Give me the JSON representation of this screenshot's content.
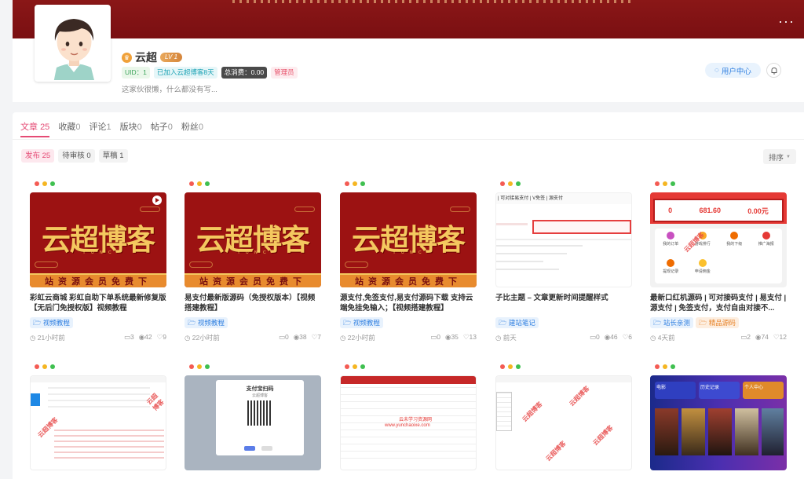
{
  "banner": {
    "more_icon": "ellipsis-icon"
  },
  "user": {
    "name": "云超",
    "level": "LV 1",
    "uid": "UID：1",
    "joined": "已加入云超博客8天",
    "spend": "总消费：0.00",
    "role": "管理员",
    "bio": "这家伙很懒，什么都没有写...",
    "user_center": "用户中心"
  },
  "tabs": [
    {
      "label": "文章",
      "count": "25"
    },
    {
      "label": "收藏",
      "count": "0"
    },
    {
      "label": "评论",
      "count": "1"
    },
    {
      "label": "版块",
      "count": "0"
    },
    {
      "label": "帖子",
      "count": "0"
    },
    {
      "label": "粉丝",
      "count": "0"
    }
  ],
  "subtabs": [
    {
      "label": "发布 25"
    },
    {
      "label": "待审核 0"
    },
    {
      "label": "草稿 1"
    }
  ],
  "sort_label": "排序",
  "red_banner": {
    "big": "云超博客",
    "sub": "Y U N C",
    "strip": "站资源会员免费下"
  },
  "cards": [
    {
      "title": "彩虹云商城 彩虹自助下单系统最新修复版【无后门免授权版】视频教程",
      "tags": [
        {
          "label": "视频教程"
        }
      ],
      "time": "21小时前",
      "comments": "3",
      "views": "42",
      "likes": "9"
    },
    {
      "title": "易支付最新版源码（免授权版本）【视频搭建教程】",
      "tags": [
        {
          "label": "视频教程"
        }
      ],
      "time": "22小时前",
      "comments": "0",
      "views": "38",
      "likes": "7"
    },
    {
      "title": "源支付,免签支付,易支付源码下载 支持云端免挂免输入；【视频搭建教程】",
      "tags": [
        {
          "label": "视频教程"
        }
      ],
      "time": "22小时前",
      "comments": "0",
      "views": "35",
      "likes": "13"
    },
    {
      "title": "子比主题 – 文章更新时间提醒样式",
      "tags": [
        {
          "label": "建站笔记"
        }
      ],
      "time": "前天",
      "comments": "0",
      "views": "46",
      "likes": "6"
    },
    {
      "title": "最新口红机源码 | 可对接码支付 | 易支付 | 源支付 | 免签支付，支付自由对接不...",
      "tags": [
        {
          "label": "站长亲测"
        },
        {
          "label": "精品源码"
        }
      ],
      "time": "4天前",
      "comments": "2",
      "views": "74",
      "likes": "12"
    }
  ],
  "thumb4": {
    "header": "| 可对接易支付 | V免签 | 源支付"
  },
  "thumb5": {
    "stats": [
      "0",
      "681.60",
      "0.00元"
    ],
    "labels": [
      "我的订单",
      "游戏排行",
      "我的下级",
      "推广海报",
      "提现记录",
      "申请佣金"
    ]
  },
  "thumb7": {
    "title": "支付宝扫码",
    "subtitle": "云超博客"
  },
  "thumb8": {
    "watermark": "云未学习资源网",
    "url": "www.yunchaoixe.com"
  },
  "thumb10": {
    "titles": [
      "电影",
      "历史记录",
      "个人中心"
    ]
  },
  "colors": {
    "accent": "#e54b75",
    "banner": "#7a0f12",
    "blue": "#2f7fe0"
  }
}
